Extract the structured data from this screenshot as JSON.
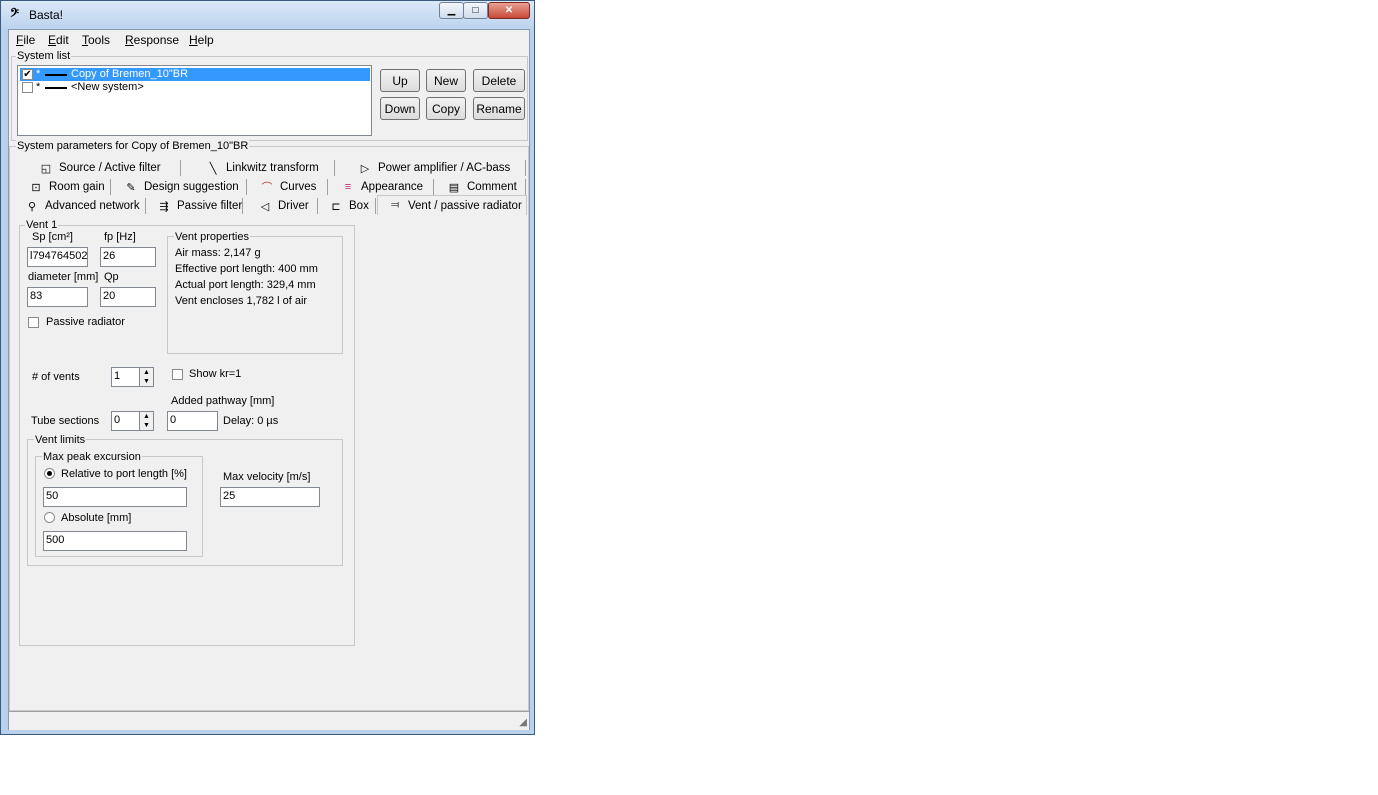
{
  "window": {
    "title": "Basta!"
  },
  "menu": [
    "File",
    "Edit",
    "Tools",
    "Response",
    "Help"
  ],
  "system_list": {
    "label": "System list",
    "rows": [
      {
        "checked": true,
        "marker": "*",
        "name": "Copy of Bremen_10\"BR",
        "selected": true
      },
      {
        "checked": false,
        "marker": "*",
        "name": "<New system>",
        "selected": false
      }
    ],
    "buttons": {
      "up": "Up",
      "new": "New",
      "delete": "Delete",
      "down": "Down",
      "copy": "Copy",
      "rename": "Rename"
    }
  },
  "params_label": "System parameters for Copy of Bremen_10\"BR",
  "tabs": {
    "row1": [
      "Source / Active filter",
      "Linkwitz transform",
      "Power amplifier / AC-bass"
    ],
    "row2": [
      "Room gain",
      "Design suggestion",
      "Curves",
      "Appearance",
      "Comment"
    ],
    "row3": [
      "Advanced network",
      "Passive filter",
      "Driver",
      "Box",
      "Vent / passive radiator"
    ]
  },
  "vent": {
    "group_label": "Vent 1",
    "sp_label": "Sp [cm²]",
    "sp_value": "l794764502",
    "fp_label": "fp [Hz]",
    "fp_value": "26",
    "diameter_label": "diameter [mm]",
    "diameter_value": "83",
    "qp_label": "Qp",
    "qp_value": "20",
    "passive_radiator_label": "Passive radiator",
    "properties": {
      "label": "Vent properties",
      "air_mass": "Air mass: 2,147 g",
      "effective_length": "Effective port length: 400 mm",
      "actual_length": "Actual port length: 329,4 mm",
      "encloses": "Vent encloses 1,782 l of air"
    },
    "num_vents_label": "# of vents",
    "num_vents_value": "1",
    "show_kr_label": "Show kr=1",
    "tube_sections_label": "Tube sections",
    "tube_sections_value": "0",
    "added_pathway_label": "Added pathway [mm]",
    "added_pathway_value": "0",
    "delay_text": "Delay: 0 µs",
    "limits": {
      "label": "Vent limits",
      "excursion_label": "Max peak excursion",
      "relative_label": "Relative to port length [%]",
      "relative_value": "50",
      "absolute_label": "Absolute [mm]",
      "absolute_value": "500",
      "velocity_label": "Max velocity [m/s]",
      "velocity_value": "25"
    }
  }
}
